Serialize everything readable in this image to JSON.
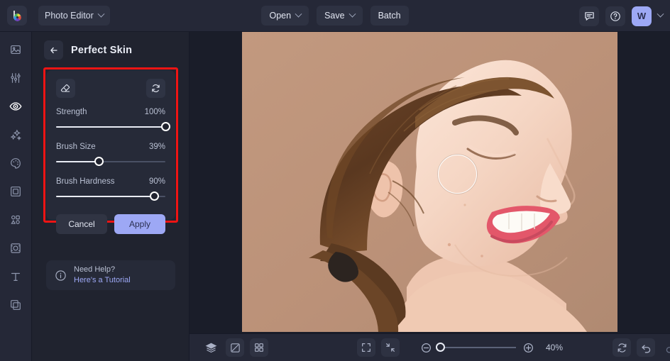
{
  "app": {
    "logo_icon": "color-wheel-logo-icon",
    "selector_label": "Photo Editor"
  },
  "topbar": {
    "open_label": "Open",
    "save_label": "Save",
    "batch_label": "Batch",
    "feedback_icon": "chat-bubble-icon",
    "help_icon": "question-circle-icon",
    "avatar_initial": "W"
  },
  "rail": {
    "items": [
      {
        "icon": "image-icon",
        "name": "sidebar-item-image",
        "active": false
      },
      {
        "icon": "sliders-icon",
        "name": "sidebar-item-adjust",
        "active": false
      },
      {
        "icon": "eye-retouch-icon",
        "name": "sidebar-item-retouch",
        "active": true
      },
      {
        "icon": "sparkles-icon",
        "name": "sidebar-item-effects",
        "active": false
      },
      {
        "icon": "palette-icon",
        "name": "sidebar-item-color",
        "active": false
      },
      {
        "icon": "frame-icon",
        "name": "sidebar-item-frame",
        "active": false
      },
      {
        "icon": "shapes-icon",
        "name": "sidebar-item-shapes",
        "active": false
      },
      {
        "icon": "crop-resize-icon",
        "name": "sidebar-item-resize",
        "active": false
      },
      {
        "icon": "text-icon",
        "name": "sidebar-item-text",
        "active": false
      },
      {
        "icon": "layers-copy-icon",
        "name": "sidebar-item-layers",
        "active": false
      }
    ]
  },
  "panel": {
    "back_icon": "arrow-left-icon",
    "title": "Perfect Skin",
    "tools": {
      "eraser_icon": "eraser-icon",
      "reset_icon": "reset-refresh-icon"
    },
    "sliders": [
      {
        "label": "Strength",
        "value": "100%",
        "percent": 100
      },
      {
        "label": "Brush Size",
        "value": "39%",
        "percent": 39
      },
      {
        "label": "Brush Hardness",
        "value": "90%",
        "percent": 90
      }
    ],
    "cancel_label": "Cancel",
    "apply_label": "Apply",
    "help": {
      "icon": "info-circle-icon",
      "line1": "Need Help?",
      "line2": "Here's a Tutorial"
    },
    "highlight_color": "#ef1414"
  },
  "canvas": {
    "brush_cursor_name": "brush-cursor-circle",
    "photo_alt": "woman-profile-portrait"
  },
  "bottombar": {
    "left_icons": [
      {
        "icon": "layers-icon",
        "name": "layers-button",
        "boxed": false
      },
      {
        "icon": "compare-icon",
        "name": "compare-button",
        "boxed": true
      },
      {
        "icon": "grid-icon",
        "name": "grid-button",
        "boxed": true
      }
    ],
    "fit_icons": [
      {
        "icon": "fullscreen-icon",
        "name": "fit-screen-button",
        "boxed": true
      },
      {
        "icon": "collapse-icon",
        "name": "actual-size-button",
        "boxed": true
      }
    ],
    "zoom_out_icon": "zoom-out-icon",
    "zoom_in_icon": "zoom-in-icon",
    "zoom_level": "40%",
    "zoom_percent": 3,
    "right_icons": [
      {
        "icon": "rotate-icon",
        "name": "rotate-button",
        "boxed": true,
        "dim": false
      },
      {
        "icon": "undo-icon",
        "name": "undo-button",
        "boxed": true,
        "dim": false
      },
      {
        "icon": "redo-icon",
        "name": "redo-button",
        "boxed": false,
        "dim": true
      },
      {
        "icon": "history-icon",
        "name": "history-button",
        "boxed": true,
        "dim": false
      }
    ]
  }
}
